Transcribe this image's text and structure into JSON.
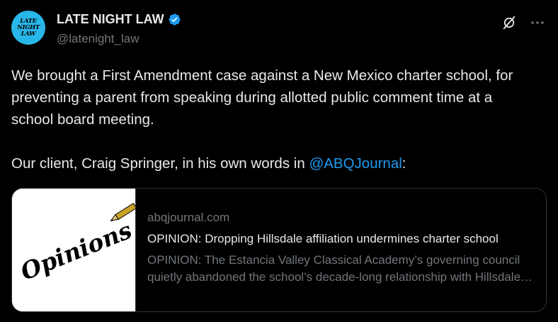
{
  "author": {
    "avatar_lines": [
      "LATE",
      "NIGHT",
      "LAW"
    ],
    "display_name": "LATE NIGHT LAW",
    "handle": "@latenight_law",
    "verified": true,
    "verified_color": "#1d9bf0"
  },
  "actions": {
    "grok_icon": "grok-icon",
    "more_icon": "more-icon"
  },
  "tweet": {
    "text_part1": "We brought a First Amendment case against a New Mexico charter school, for preventing a parent from speaking during allotted public comment time at a school board meeting.\n\nOur client, Craig Springer, in his own words in ",
    "mention": "@ABQJournal",
    "text_part2": ":"
  },
  "link_card": {
    "thumbnail_text": "Opinions",
    "domain": "abqjournal.com",
    "title": "OPINION: Dropping Hillsdale affiliation undermines charter school",
    "description": "OPINION: The Estancia Valley Classical Academy’s governing council quietly abandoned the school’s decade-long relationship with Hillsdale College"
  },
  "colors": {
    "background": "#000000",
    "text": "#e7e9ea",
    "secondary": "#71767b",
    "accent": "#1d9bf0",
    "avatar_bg": "#29b6e8"
  }
}
